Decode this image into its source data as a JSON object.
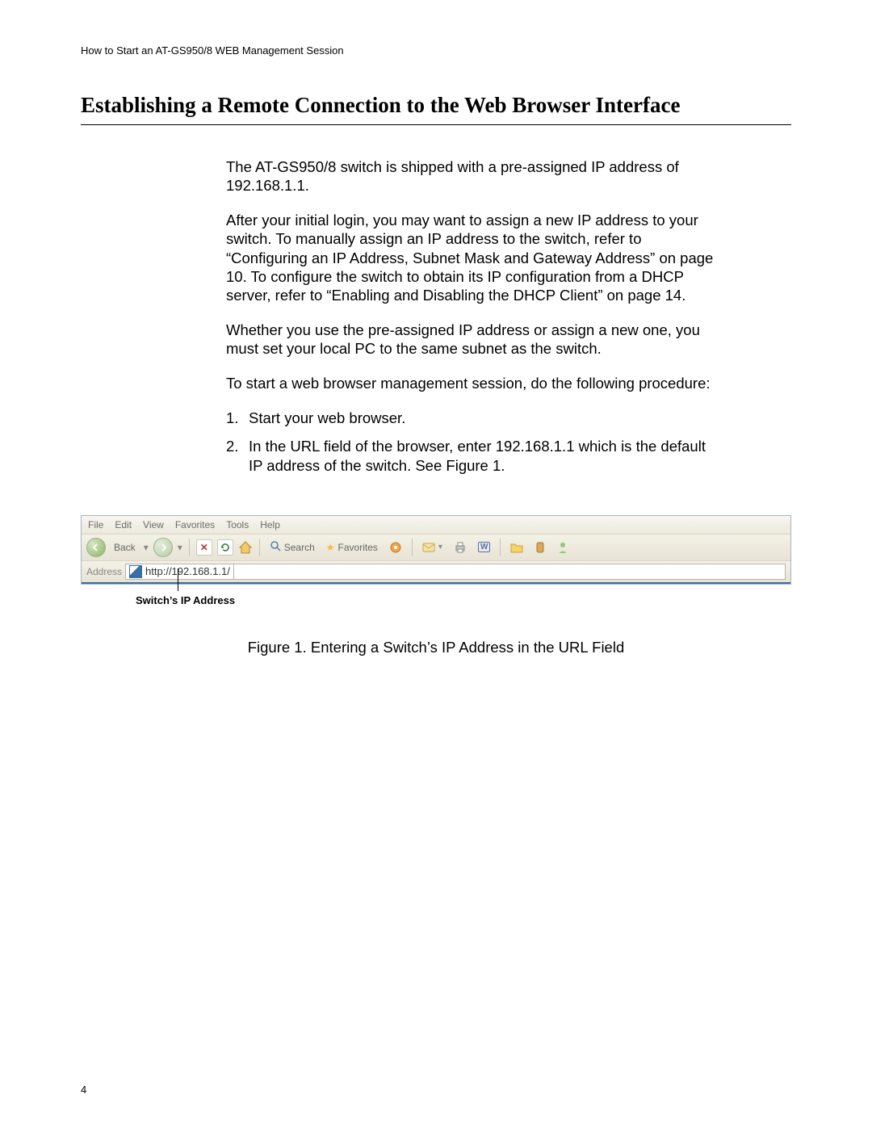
{
  "header": {
    "running_head": "How to Start an AT-GS950/8 WEB Management Session"
  },
  "section": {
    "title": "Establishing a Remote Connection to the Web Browser Interface"
  },
  "body": {
    "p1": "The AT-GS950/8 switch is shipped with a pre-assigned IP address of 192.168.1.1.",
    "p2": "After your initial login, you may want to assign a new IP address to your switch. To manually assign an IP address to the switch, refer to “Configuring an IP Address, Subnet Mask and Gateway Address” on page 10. To configure the switch to obtain its IP configuration from a DHCP server, refer to “Enabling and Disabling the DHCP Client” on page 14.",
    "p3": "Whether you use the pre-assigned IP address or assign a new one, you must set your local PC to the same subnet as the switch.",
    "p4": "To start a web browser management session, do the following procedure:",
    "step1": "Start your web browser.",
    "step2": "In the URL field of the browser, enter 192.168.1.1 which is the default IP address of the switch. See Figure 1."
  },
  "browser": {
    "menu": {
      "file": "File",
      "edit": "Edit",
      "view": "View",
      "favorites": "Favorites",
      "tools": "Tools",
      "help": "Help"
    },
    "toolbar": {
      "back": "Back",
      "search": "Search",
      "favorites": "Favorites"
    },
    "address_label": "Address",
    "url": "http://192.168.1.1/"
  },
  "figure": {
    "callout": "Switch’s IP Address",
    "caption": "Figure 1. Entering a Switch’s IP Address in the URL Field"
  },
  "page_number": "4"
}
